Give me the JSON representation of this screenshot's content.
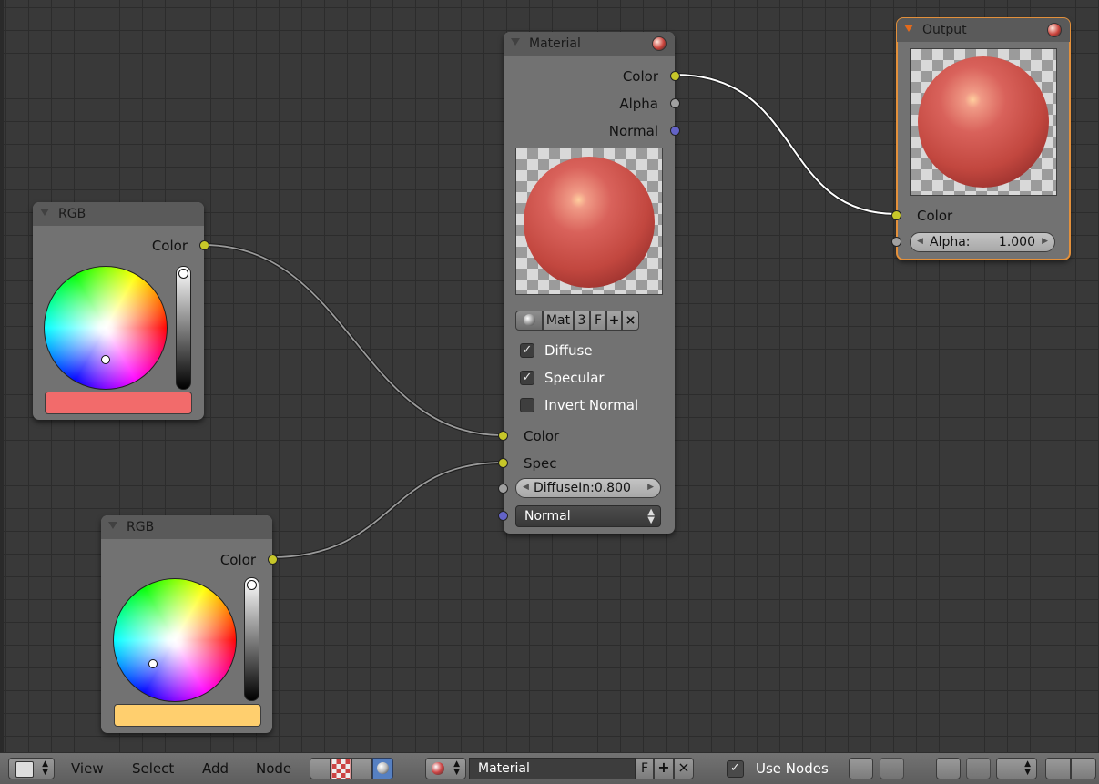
{
  "nodes": {
    "material": {
      "title": "Material",
      "outputs": [
        "Color",
        "Alpha",
        "Normal"
      ],
      "datablock": {
        "name": "Mat",
        "users": "3",
        "fake": "F",
        "add": "+",
        "unlink": "×"
      },
      "options": [
        {
          "label": "Diffuse",
          "checked": true
        },
        {
          "label": "Specular",
          "checked": true
        },
        {
          "label": "Invert Normal",
          "checked": false
        }
      ],
      "inputs": {
        "color": "Color",
        "spec": "Spec",
        "diffuse_intensity": "DiffuseIn:0.800",
        "normal": "Normal"
      }
    },
    "output": {
      "title": "Output",
      "inputs": {
        "color": "Color",
        "alpha_label": "Alpha:",
        "alpha_value": "1.000"
      }
    },
    "rgb_top": {
      "title": "RGB",
      "output": "Color",
      "swatch_color": "#f26b6b"
    },
    "rgb_bottom": {
      "title": "RGB",
      "output": "Color",
      "swatch_color": "#ffcf6e"
    }
  },
  "header": {
    "menus": [
      "View",
      "Select",
      "Add",
      "Node"
    ],
    "material_field": "Material",
    "fake_user": "F",
    "use_nodes": {
      "label": "Use Nodes",
      "checked": true
    }
  },
  "colors": {
    "socket_color": "#c7c729",
    "socket_value": "#a1a1a1",
    "socket_vector": "#6363c7",
    "active_outline": "#e3903b"
  }
}
